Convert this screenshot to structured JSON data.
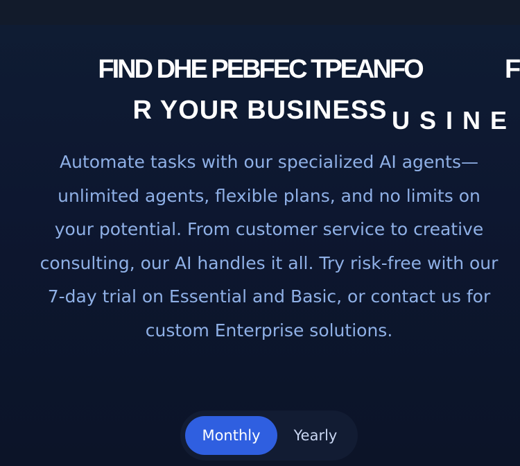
{
  "hero": {
    "headline_line1": "FIND DHE PEBFEC TPEANFO",
    "headline_line1_trailing": "F",
    "headline_line2": "R YOUR BUSINESS",
    "headline_ghost": "USINE",
    "description": "Automate tasks with our specialized AI agents—unlimited agents, flexible plans, and no limits on your potential. From customer service to creative consulting, our AI handles it all. Try risk-free with our 7-day trial on Essential and Basic, or contact us for custom Enterprise solutions."
  },
  "billing_toggle": {
    "monthly_label": "Monthly",
    "yearly_label": "Yearly",
    "selected": "Monthly"
  },
  "colors": {
    "background": "#0d1526",
    "accent": "#2f5fe0",
    "description_text": "#8fb0e6",
    "headline_text": "#ffffff"
  }
}
